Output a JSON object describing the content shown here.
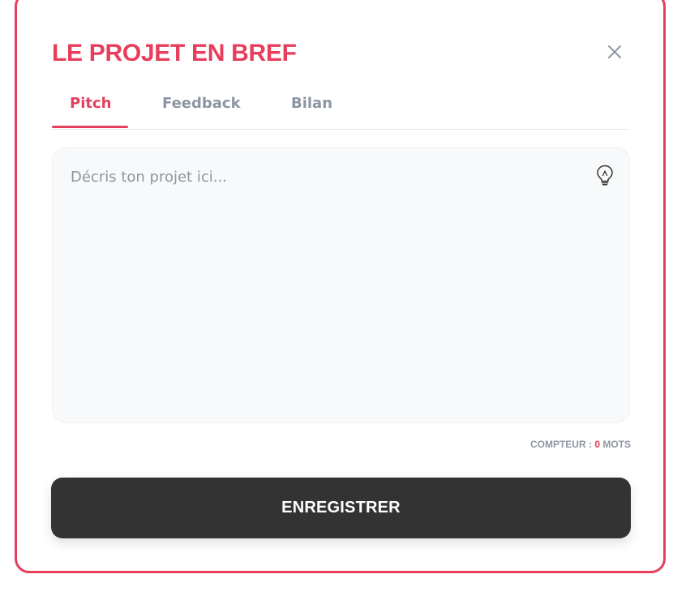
{
  "modal": {
    "title": "LE PROJET EN BREF",
    "close_icon": "close-icon",
    "accent_color": "#e63e5c"
  },
  "tabs": [
    {
      "label": "Pitch",
      "active": true
    },
    {
      "label": "Feedback",
      "active": false
    },
    {
      "label": "Bilan",
      "active": false
    }
  ],
  "editor": {
    "value": "",
    "placeholder": "Décris ton projet ici...",
    "hint_icon": "lightbulb-icon"
  },
  "counter": {
    "prefix": "COMPTEUR : ",
    "count": "0",
    "suffix": " MOTS"
  },
  "save_button": {
    "label": "ENREGISTRER",
    "color": "#333333"
  }
}
